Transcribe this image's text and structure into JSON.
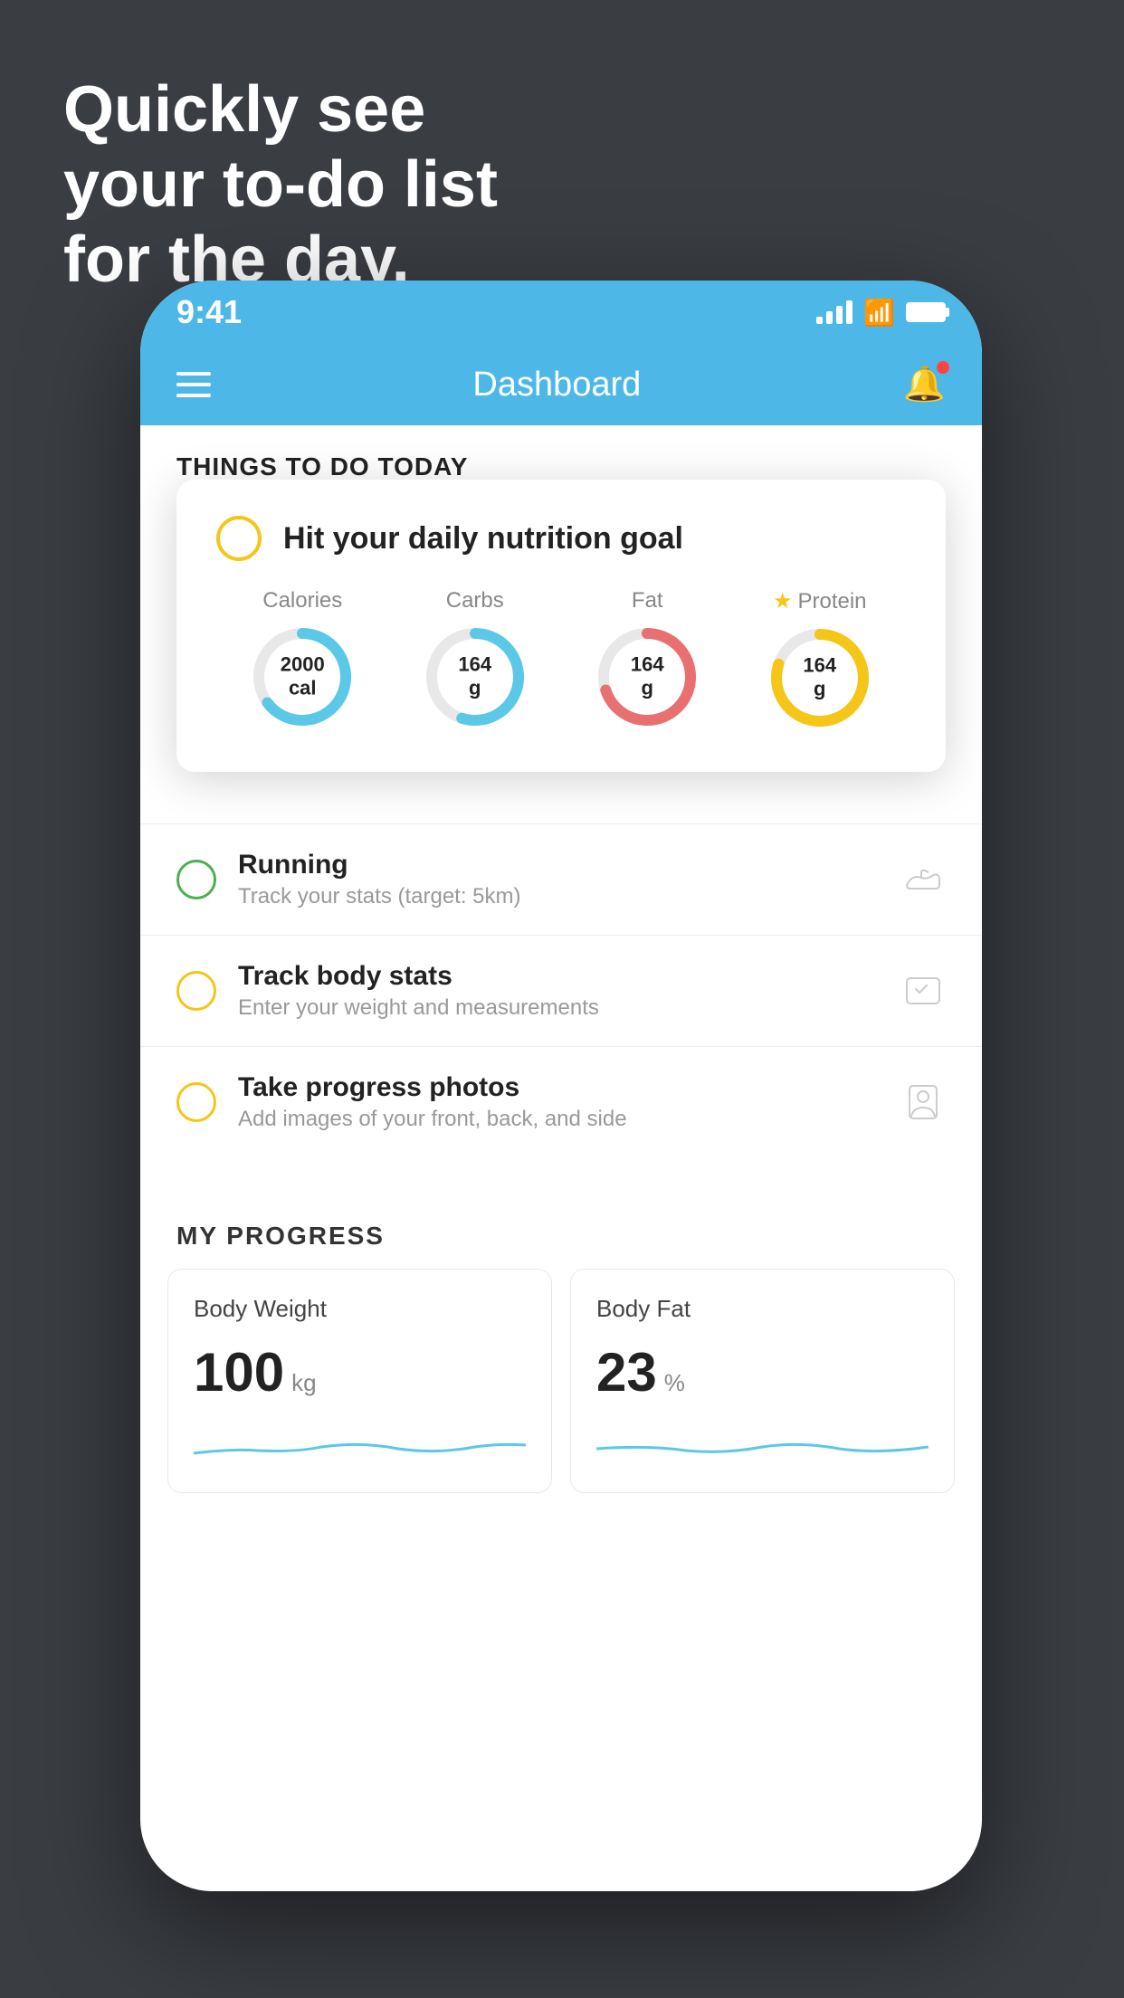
{
  "headline": {
    "line1": "Quickly see",
    "line2": "your to-do list",
    "line3": "for the day."
  },
  "statusBar": {
    "time": "9:41"
  },
  "navBar": {
    "title": "Dashboard"
  },
  "sectionHeader": "THINGS TO DO TODAY",
  "floatingCard": {
    "title": "Hit your daily nutrition goal",
    "nutrition": [
      {
        "label": "Calories",
        "value": "2000",
        "unit": "cal",
        "color": "#5bc8e8",
        "progress": 0.65
      },
      {
        "label": "Carbs",
        "value": "164",
        "unit": "g",
        "color": "#5bc8e8",
        "progress": 0.55
      },
      {
        "label": "Fat",
        "value": "164",
        "unit": "g",
        "color": "#e87070",
        "progress": 0.7
      },
      {
        "label": "Protein",
        "value": "164",
        "unit": "g",
        "color": "#f5c518",
        "progress": 0.8,
        "starred": true
      }
    ]
  },
  "todoItems": [
    {
      "title": "Running",
      "subtitle": "Track your stats (target: 5km)",
      "circleColor": "green",
      "iconType": "shoe"
    },
    {
      "title": "Track body stats",
      "subtitle": "Enter your weight and measurements",
      "circleColor": "yellow",
      "iconType": "scale"
    },
    {
      "title": "Take progress photos",
      "subtitle": "Add images of your front, back, and side",
      "circleColor": "yellow",
      "iconType": "portrait"
    }
  ],
  "progressSection": {
    "header": "MY PROGRESS",
    "cards": [
      {
        "title": "Body Weight",
        "value": "100",
        "unit": "kg"
      },
      {
        "title": "Body Fat",
        "value": "23",
        "unit": "%"
      }
    ]
  }
}
